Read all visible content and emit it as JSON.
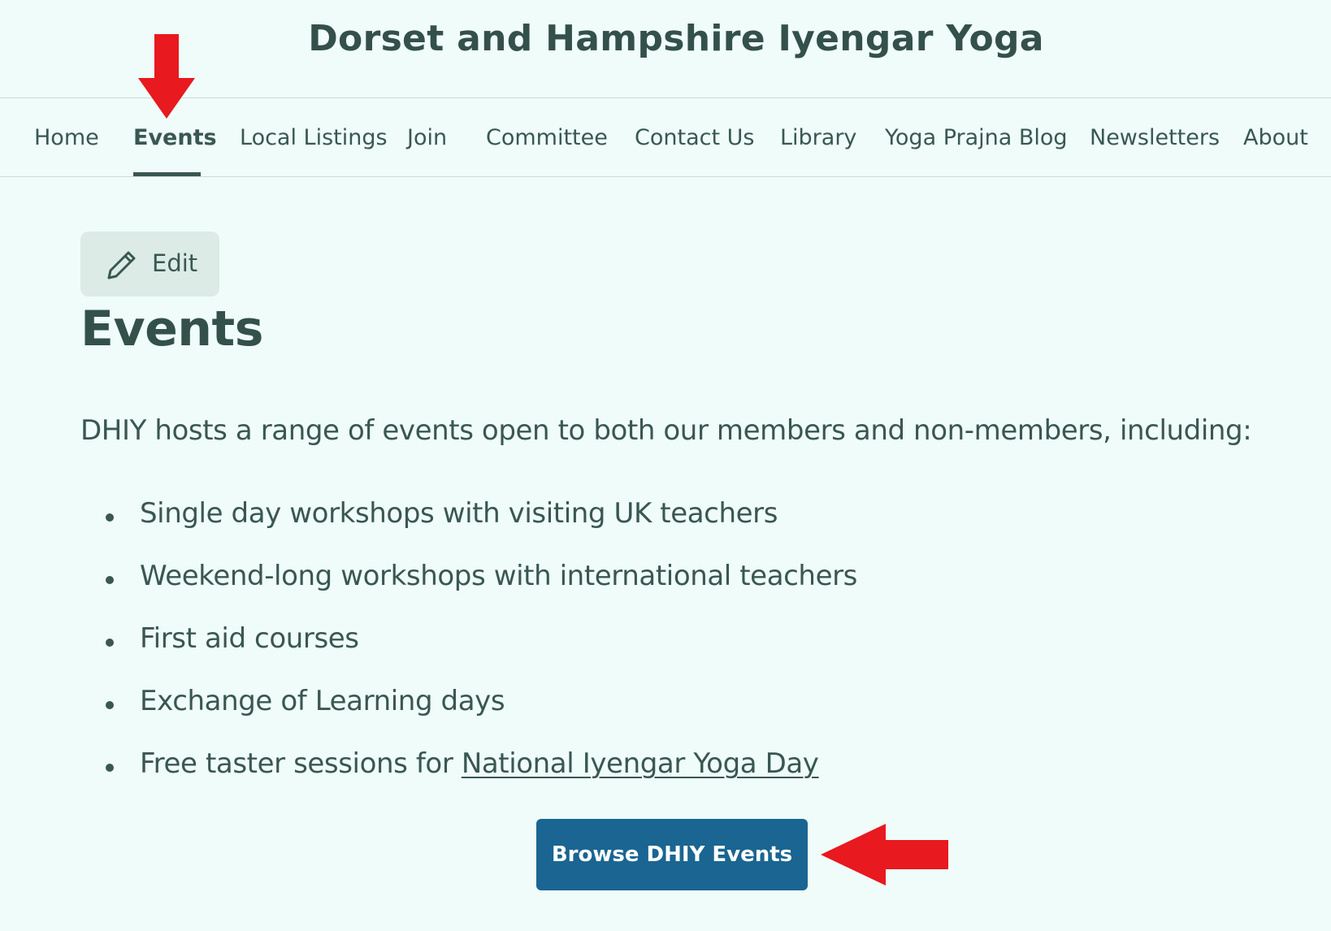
{
  "site": {
    "title": "Dorset and Hampshire Iyengar Yoga"
  },
  "nav": {
    "items": [
      {
        "label": "Home",
        "active": false
      },
      {
        "label": "Events",
        "active": true
      },
      {
        "label": "Local Listings",
        "active": false
      },
      {
        "label": "Join",
        "active": false
      },
      {
        "label": "Committee",
        "active": false
      },
      {
        "label": "Contact Us",
        "active": false
      },
      {
        "label": "Library",
        "active": false
      },
      {
        "label": "Yoga Prajna Blog",
        "active": false
      },
      {
        "label": "Newsletters",
        "active": false
      },
      {
        "label": "About",
        "active": false
      }
    ]
  },
  "edit": {
    "label": "Edit",
    "icon": "pencil-icon"
  },
  "page": {
    "title": "Events",
    "intro": "DHIY hosts a range of events open to both our members and non-members, including:",
    "list": [
      "Single day workshops with visiting UK teachers",
      "Weekend-long workshops with international teachers",
      "First aid courses",
      "Exchange of Learning days"
    ],
    "last_item_prefix": "Free taster sessions for ",
    "last_item_link": "National Iyengar Yoga Day",
    "button_label": "Browse DHIY Events"
  },
  "colors": {
    "background": "#effcf9",
    "text": "#3a5752",
    "button": "#1a6591",
    "annotation_arrow": "#e8191f",
    "edit_bg": "#dcebe6"
  }
}
